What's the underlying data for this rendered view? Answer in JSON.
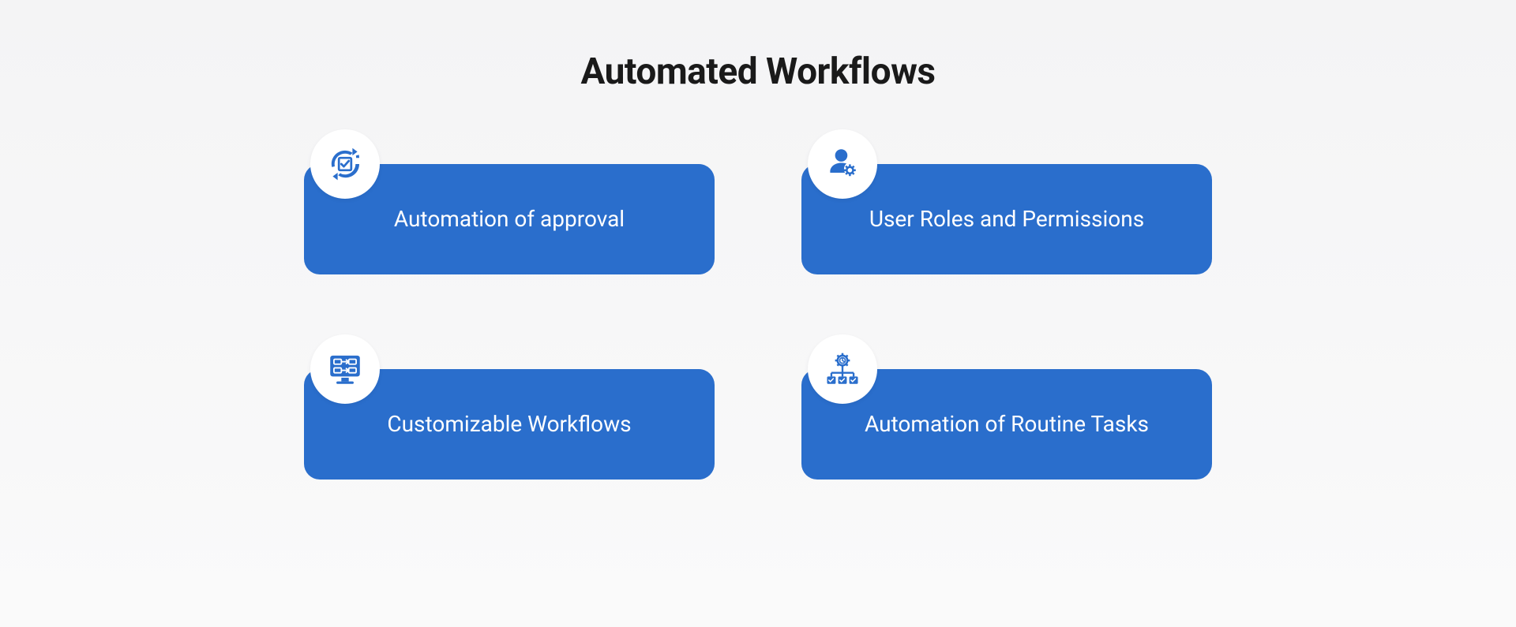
{
  "section": {
    "title": "Automated Workflows",
    "cards": [
      {
        "label": "Automation of approval",
        "icon": "cycle-check-icon"
      },
      {
        "label": "User Roles and Permissions",
        "icon": "user-gear-icon"
      },
      {
        "label": "Customizable Workflows",
        "icon": "monitor-flow-icon"
      },
      {
        "label": "Automation of Routine Tasks",
        "icon": "gear-tree-icon"
      }
    ]
  },
  "colors": {
    "accent": "#2a6ecc",
    "badge_bg": "#ffffff",
    "text_dark": "#1a1a1a",
    "text_light": "#ffffff"
  }
}
